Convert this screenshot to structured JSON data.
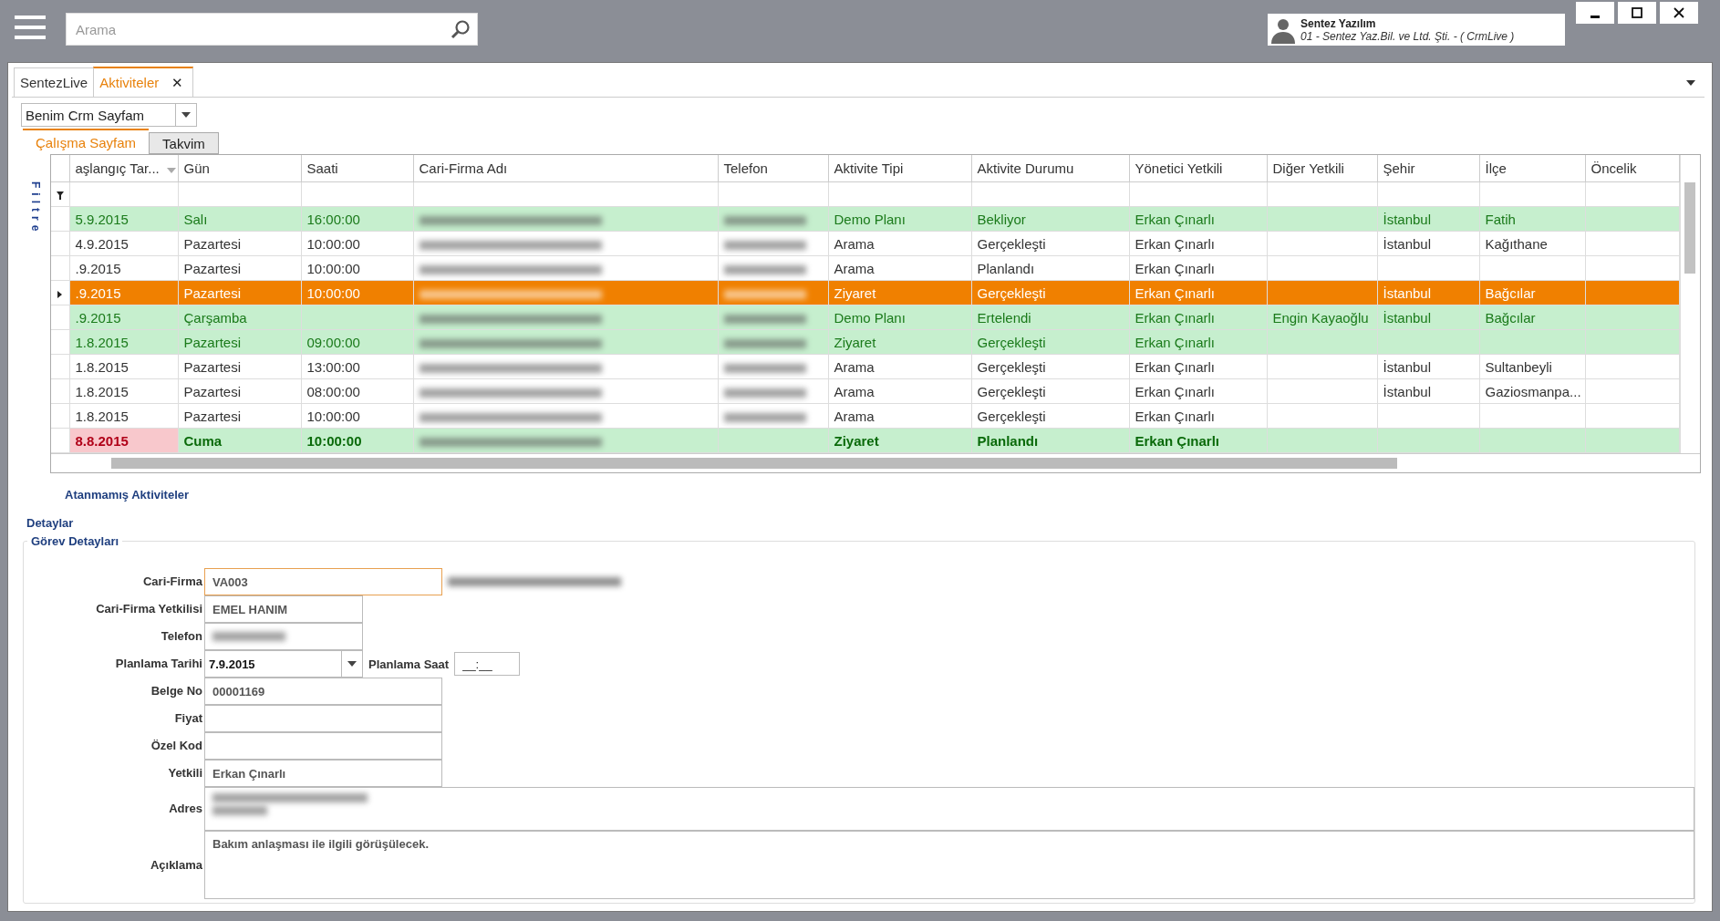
{
  "search": {
    "placeholder": "Arama"
  },
  "user": {
    "name": "Sentez Yazılım",
    "company": "01 - Sentez Yaz.Bil. ve Ltd. Şti. - ( CrmLive )"
  },
  "doc_tabs": [
    {
      "label": "SentezLive",
      "selected": false,
      "closable": false
    },
    {
      "label": "Aktiviteler",
      "selected": true,
      "closable": true
    }
  ],
  "close_glyph": "✕",
  "page_select": {
    "value": "Benim Crm Sayfam"
  },
  "view_tabs": [
    {
      "label": "Çalışma Sayfam",
      "selected": true
    },
    {
      "label": "Takvim",
      "selected": false
    }
  ],
  "filter_label": "Filtre",
  "table": {
    "columns": [
      "aşlangıç Tar...",
      "Gün",
      "Saati",
      "Cari-Firma Adı",
      "Telefon",
      "Aktivite Tipi",
      "Aktivite Durumu",
      "Yönetici Yetkili",
      "Diğer Yetkili",
      "Şehir",
      "İlçe",
      "Öncelik"
    ],
    "rows": [
      {
        "kind": "green",
        "selected": false,
        "cells": [
          "5.9.2015",
          "Salı",
          "16:00:00",
          {
            "blurred": true
          },
          {
            "blurred": true
          },
          "Demo Planı",
          "Bekliyor",
          "Erkan Çınarlı",
          "",
          "İstanbul",
          "Fatih",
          ""
        ]
      },
      {
        "kind": "plain",
        "selected": false,
        "cells": [
          "4.9.2015",
          "Pazartesi",
          "10:00:00",
          {
            "blurred": true
          },
          {
            "blurred": true
          },
          "Arama",
          "Gerçekleşti",
          "Erkan Çınarlı",
          "",
          "İstanbul",
          "Kağıthane",
          ""
        ]
      },
      {
        "kind": "plain",
        "selected": false,
        "cells": [
          ".9.2015",
          "Pazartesi",
          "10:00:00",
          {
            "blurred": true
          },
          {
            "blurred": true
          },
          "Arama",
          "Planlandı",
          "Erkan Çınarlı",
          "",
          "",
          "",
          ""
        ]
      },
      {
        "kind": "plain",
        "selected": true,
        "cells": [
          ".9.2015",
          "Pazartesi",
          "10:00:00",
          {
            "blurred": true
          },
          {
            "blurred": true
          },
          "Ziyaret",
          "Gerçekleşti",
          "Erkan Çınarlı",
          "",
          "İstanbul",
          "Bağcılar",
          ""
        ]
      },
      {
        "kind": "green",
        "selected": false,
        "cells": [
          ".9.2015",
          "Çarşamba",
          "",
          {
            "blurred": true
          },
          {
            "blurred": true
          },
          "Demo Planı",
          "Ertelendi",
          "Erkan Çınarlı",
          "Engin Kayaoğlu",
          "İstanbul",
          "Bağcılar",
          ""
        ]
      },
      {
        "kind": "green",
        "selected": false,
        "cells": [
          "1.8.2015",
          "Pazartesi",
          "09:00:00",
          {
            "blurred": true
          },
          {
            "blurred": true
          },
          "Ziyaret",
          "Gerçekleşti",
          "Erkan Çınarlı",
          "",
          "",
          "",
          ""
        ]
      },
      {
        "kind": "plain",
        "selected": false,
        "cells": [
          "1.8.2015",
          "Pazartesi",
          "13:00:00",
          {
            "blurred": true
          },
          {
            "blurred": true
          },
          "Arama",
          "Gerçekleşti",
          "Erkan Çınarlı",
          "",
          "İstanbul",
          "Sultanbeyli",
          ""
        ]
      },
      {
        "kind": "plain",
        "selected": false,
        "cells": [
          "1.8.2015",
          "Pazartesi",
          "08:00:00",
          {
            "blurred": true
          },
          {
            "blurred": true
          },
          "Arama",
          "Gerçekleşti",
          "Erkan Çınarlı",
          "",
          "İstanbul",
          "Gaziosmanpa...",
          ""
        ]
      },
      {
        "kind": "plain",
        "selected": false,
        "cells": [
          "1.8.2015",
          "Pazartesi",
          "10:00:00",
          {
            "blurred": true
          },
          {
            "blurred": true
          },
          "Arama",
          "Gerçekleşti",
          "Erkan Çınarlı",
          "",
          "",
          "",
          ""
        ]
      },
      {
        "kind": "new",
        "selected": false,
        "cells": [
          "8.8.2015",
          "Cuma",
          "10:00:00",
          {
            "blurred": true
          },
          "",
          "Ziyaret",
          "Planlandı",
          "Erkan Çınarlı",
          "",
          "",
          "",
          ""
        ]
      }
    ]
  },
  "unassigned_link": "Atanmamış Aktiviteler",
  "details_title": "Detaylar",
  "group_title": "Görev Detayları",
  "form": [
    {
      "kind": "text",
      "label": "Cari-Firma",
      "value": "VA003",
      "focused": true,
      "side_blurred": true
    },
    {
      "kind": "short",
      "label": "Cari-Firma Yetkilisi",
      "value": "EMEL HANIM"
    },
    {
      "kind": "short",
      "label": "Telefon",
      "blurred": true
    },
    {
      "kind": "date",
      "label": "Planlama Tarihi",
      "value": "7.9.2015",
      "time_label": "Planlama Saat",
      "time_value": "__:__"
    },
    {
      "kind": "text",
      "label": "Belge No",
      "value": "00001169"
    },
    {
      "kind": "text",
      "label": "Fiyat"
    },
    {
      "kind": "text",
      "label": "Özel Kod"
    },
    {
      "kind": "text",
      "label": "Yetkili",
      "value": "Erkan Çınarlı"
    },
    {
      "kind": "area",
      "label": "Adres",
      "blurred": true
    },
    {
      "kind": "memo",
      "label": "Açıklama",
      "value": "Bakım anlaşması ile ilgili görüşülecek."
    }
  ]
}
